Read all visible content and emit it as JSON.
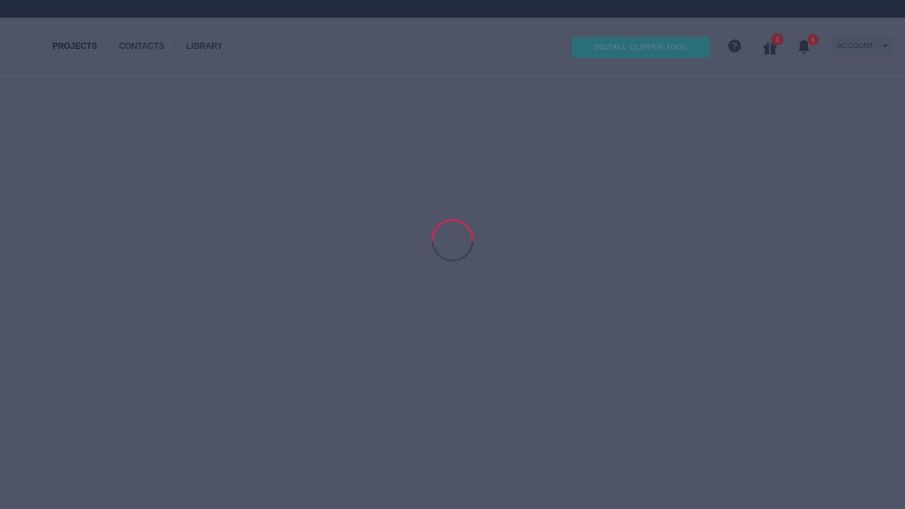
{
  "nav": {
    "items": [
      {
        "label": "PROJECTS"
      },
      {
        "label": "CONTACTS"
      },
      {
        "label": "LIBRARY"
      }
    ]
  },
  "header": {
    "install_button_label": "INSTALL CLIPPER TOOL",
    "gift_badge_count": "1",
    "notification_badge_count": "6",
    "account_label": "ACCOUNT"
  },
  "icons": {
    "help": "help-circle-icon",
    "gift": "gift-icon",
    "notifications": "bell-icon",
    "account_caret": "caret-down-icon",
    "loading": "loading-spinner-icon"
  },
  "colors": {
    "overlay_background": "#4f5566",
    "top_strip": "#222a3d",
    "accent_button": "#2a6e77",
    "spinner_accent": "#d6245a",
    "badge": "#7c2a3e"
  }
}
